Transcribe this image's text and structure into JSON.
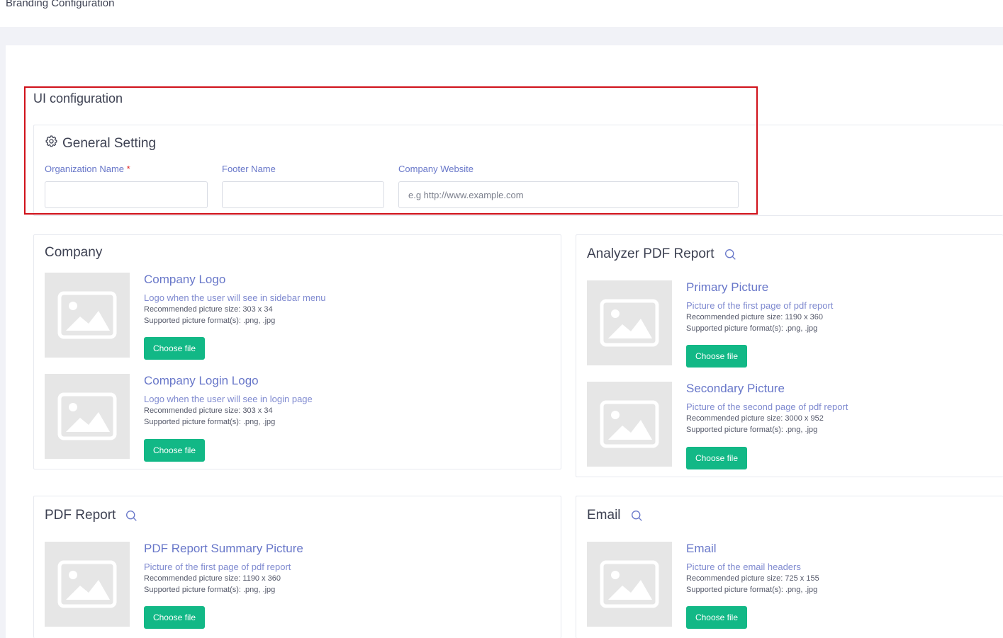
{
  "page": {
    "title": "Branding Configuration"
  },
  "ui_config": {
    "section_title": "UI configuration",
    "general_setting": {
      "heading": "General Setting",
      "organization_name": {
        "label": "Organization Name",
        "required_mark": "*",
        "value": "",
        "placeholder": ""
      },
      "footer_name": {
        "label": "Footer Name",
        "value": "",
        "placeholder": ""
      },
      "company_website": {
        "label": "Company Website",
        "value": "",
        "placeholder": "e.g http://www.example.com"
      }
    }
  },
  "company": {
    "title": "Company",
    "items": [
      {
        "title": "Company Logo",
        "description": "Logo when the user will see in sidebar menu",
        "size": "Recommended picture size: 303 x 34",
        "formats": "Supported picture format(s): .png, .jpg",
        "button": "Choose file"
      },
      {
        "title": "Company Login Logo",
        "description": "Logo when the user will see in login page",
        "size": "Recommended picture size: 303 x 34",
        "formats": "Supported picture format(s): .png, .jpg",
        "button": "Choose file"
      }
    ]
  },
  "analyzer_pdf": {
    "title": "Analyzer PDF Report",
    "items": [
      {
        "title": "Primary Picture",
        "description": "Picture of the first page of pdf report",
        "size": "Recommended picture size: 1190 x 360",
        "formats": "Supported picture format(s): .png, .jpg",
        "button": "Choose file"
      },
      {
        "title": "Secondary Picture",
        "description": "Picture of the second page of pdf report",
        "size": "Recommended picture size: 3000 x 952",
        "formats": "Supported picture format(s): .png, .jpg",
        "button": "Choose file"
      }
    ]
  },
  "pdf_report": {
    "title": "PDF Report",
    "items": [
      {
        "title": "PDF Report Summary Picture",
        "description": "Picture of the first page of pdf report",
        "size": "Recommended picture size: 1190 x 360",
        "formats": "Supported picture format(s): .png, .jpg",
        "button": "Choose file"
      }
    ]
  },
  "email": {
    "title": "Email",
    "items": [
      {
        "title": "Email",
        "description": "Picture of the email headers",
        "size": "Recommended picture size: 725 x 155",
        "formats": "Supported picture format(s): .png, .jpg",
        "button": "Choose file"
      }
    ]
  },
  "colors": {
    "accent": "#6877c9",
    "button": "#12b886",
    "highlight": "#d0111a"
  },
  "icons": {
    "general_setting": "gear-icon",
    "preview": "search-icon",
    "placeholder": "image-placeholder-icon"
  }
}
